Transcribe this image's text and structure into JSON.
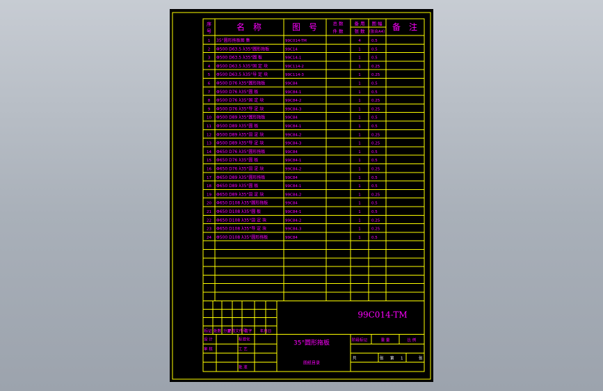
{
  "header": {
    "seq": "序号",
    "name": "名　称",
    "drawing_no": "图　号",
    "total_qty": "总 数\n件 数",
    "single_qty": "备 用\n张 数",
    "sheet_size": "图 幅\n（张合A4）",
    "remark": "备　注"
  },
  "rows": [
    {
      "no": "1",
      "name": "35°圆形拖板图 集",
      "code": "99C014-TM",
      "qty": "4",
      "size": "0.5"
    },
    {
      "no": "2",
      "name": "Φ500 D63.5 λ35°圆形拖板",
      "code": "99C14",
      "qty": "1",
      "size": "0.5"
    },
    {
      "no": "3",
      "name": "Φ500 D63.5 λ35°圆 板",
      "code": "99C14-1",
      "qty": "1",
      "size": "0.5"
    },
    {
      "no": "4",
      "name": "Φ500 D63.5 λ35°固 定 块",
      "code": "99C114-2",
      "qty": "1",
      "size": "0.25"
    },
    {
      "no": "5",
      "name": "Φ500 D63.5 λ35°导 定 块",
      "code": "99C114-3",
      "qty": "1",
      "size": "0.25"
    },
    {
      "no": "6",
      "name": "Φ500 D76 λ35°圆形拖板",
      "code": "99C84",
      "qty": "1",
      "size": "0.5"
    },
    {
      "no": "7",
      "name": "Φ500 D76 λ35°圆 板",
      "code": "99C84-1",
      "qty": "1",
      "size": "0.5"
    },
    {
      "no": "8",
      "name": "Φ500 D76 λ35°固 定 块",
      "code": "99C84-2",
      "qty": "1",
      "size": "0.25"
    },
    {
      "no": "9",
      "name": "Φ500 D76 λ35°导 定 块",
      "code": "99C84-3",
      "qty": "1",
      "size": "0.25"
    },
    {
      "no": "10",
      "name": "Φ500 D89 λ35°圆形拖板",
      "code": "99C84",
      "qty": "1",
      "size": "0.5"
    },
    {
      "no": "11",
      "name": "Φ500 D89 λ35°圆 板",
      "code": "99C84-1",
      "qty": "1",
      "size": "0.5"
    },
    {
      "no": "12",
      "name": "Φ500 D89 λ35°固 定 块",
      "code": "99C84-2",
      "qty": "1",
      "size": "0.25"
    },
    {
      "no": "13",
      "name": "Φ500 D89 λ35°导 定 块",
      "code": "99C84-3",
      "qty": "1",
      "size": "0.25"
    },
    {
      "no": "14",
      "name": "Φ650 D76 λ35°圆形拖板",
      "code": "99C84",
      "qty": "1",
      "size": "0.5"
    },
    {
      "no": "15",
      "name": "Φ650 D76 λ35°圆 板",
      "code": "99C84-1",
      "qty": "1",
      "size": "0.5"
    },
    {
      "no": "16",
      "name": "Φ650 D76 λ35°固 定 块",
      "code": "99C84-2",
      "qty": "1",
      "size": "0.25"
    },
    {
      "no": "17",
      "name": "Φ650 D89 λ35°圆形拖板",
      "code": "99C84",
      "qty": "1",
      "size": "0.5"
    },
    {
      "no": "18",
      "name": "Φ650 D89 λ35°圆 板",
      "code": "99C84-1",
      "qty": "1",
      "size": "0.5"
    },
    {
      "no": "19",
      "name": "Φ650 D89 λ35°固 定 块",
      "code": "99C84-2",
      "qty": "1",
      "size": "0.25"
    },
    {
      "no": "20",
      "name": "Φ650 D108 λ35°圆形拖板",
      "code": "99C84",
      "qty": "1",
      "size": "0.5"
    },
    {
      "no": "21",
      "name": "Φ650 D108 λ35°圆 板",
      "code": "99C84-1",
      "qty": "1",
      "size": "0.5"
    },
    {
      "no": "22",
      "name": "Φ650 D108 λ35°固 定 块",
      "code": "99C84-2",
      "qty": "1",
      "size": "0.25"
    },
    {
      "no": "23",
      "name": "Φ650 D108 λ35°导 定 块",
      "code": "99C84-3",
      "qty": "1",
      "size": "0.25"
    },
    {
      "no": "24",
      "name": "Φ500 D108 λ35°圆形拖板",
      "code": "99C84",
      "qty": "1",
      "size": "0.5"
    }
  ],
  "title_block": {
    "drawing_code": "99C014-TM",
    "product_name": "35°圆形拖板",
    "doc_type": "图纸目录",
    "rev_headers": [
      "标记",
      "处数",
      "分区",
      "更改文件号",
      "签字",
      "年月日"
    ],
    "roles": [
      "设 计",
      "审 核",
      "工 艺",
      "批 准"
    ],
    "std_label": "标准化",
    "stage_label": "阶段标记",
    "weight_label": "重 量",
    "scale_label": "比 例",
    "total_label": "共",
    "sheet_label": "张",
    "page_label": "第",
    "page_no": "1",
    "page_sheet_label": "张"
  },
  "colors": {
    "sheet": "#000000",
    "lines": "#ffff00",
    "text": "#ff00ff",
    "text_white": "#ffffff"
  }
}
